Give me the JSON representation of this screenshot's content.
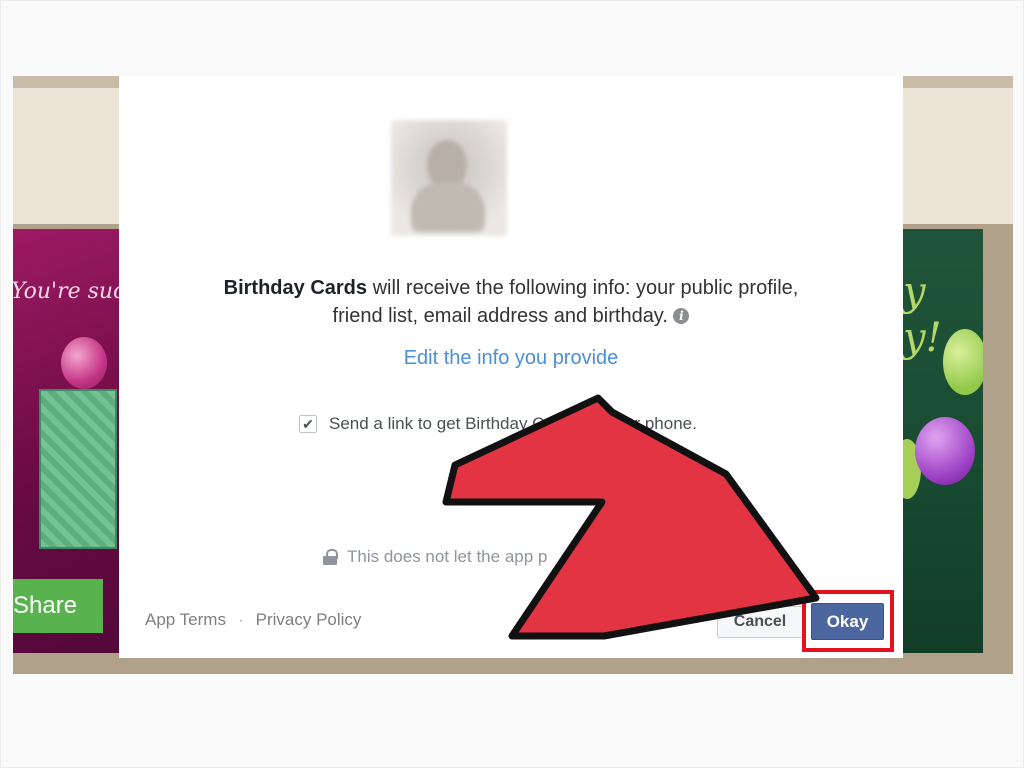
{
  "background": {
    "left_card_text": "You're such a",
    "left_share_label": "Share",
    "right_card_text": "y\ny!"
  },
  "dialog": {
    "app_name": "Birthday Cards",
    "info_text": " will receive the following info: your public profile,",
    "info_text_2": "friend list, email address and birthday.",
    "info_icon_glyph": "i",
    "edit_link": "Edit the info you provide",
    "send_link_text": "Send a link to get Birthday Card",
    "send_link_tail": "your phone.",
    "checkbox_checked": true,
    "notice_text": "This does not let the app p",
    "footer": {
      "app_terms": "App Terms",
      "separator": "·",
      "privacy_policy": "Privacy Policy"
    },
    "cancel_label": "Cancel",
    "okay_label": "Okay"
  },
  "colors": {
    "link_blue": "#4a90d9",
    "okay_blue": "#4c67a0",
    "highlight_red": "#e4121f",
    "arrow_red": "#e23443"
  },
  "icons": {
    "info": "info-icon",
    "lock": "lock-icon",
    "check": "checkmark-icon",
    "arrow": "arrow-pointer-icon"
  }
}
